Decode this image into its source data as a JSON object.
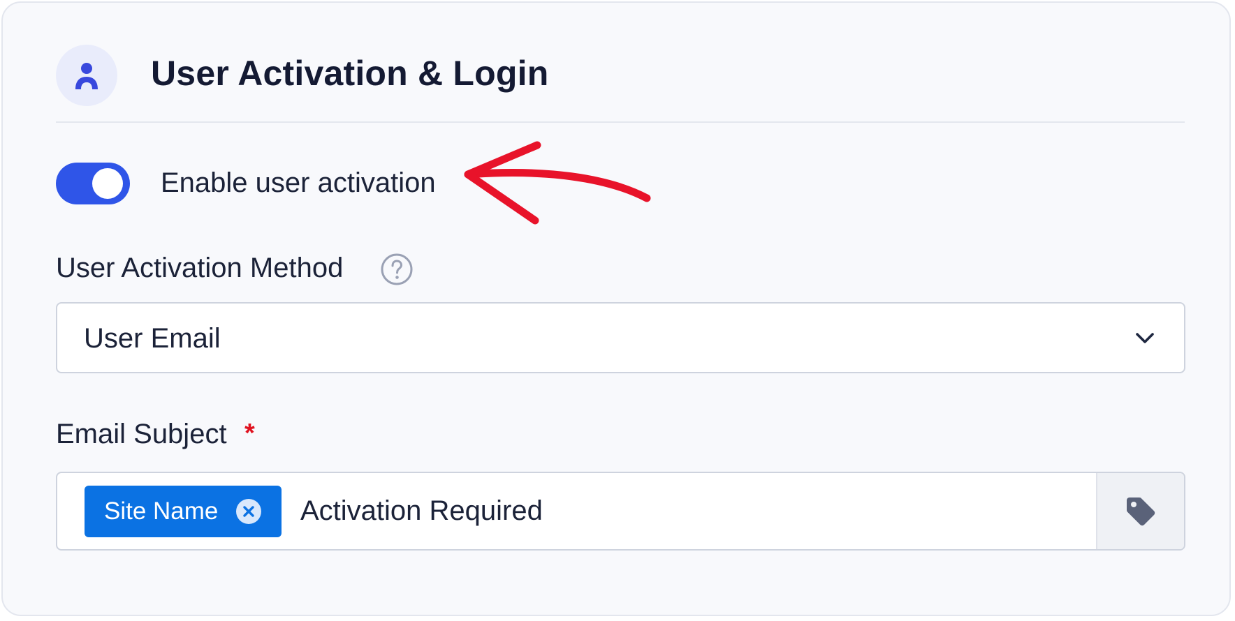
{
  "section": {
    "title": "User Activation & Login",
    "icon": "user-icon"
  },
  "activation_toggle": {
    "label": "Enable user activation",
    "on": true
  },
  "activation_method": {
    "label": "User Activation Method",
    "help_icon": "question-circle-icon",
    "selected": "User Email"
  },
  "email_subject": {
    "label": "Email Subject",
    "required_marker": "*",
    "tag_label": "Site Name",
    "text": "Activation Required",
    "tag_button_icon": "tag-icon"
  },
  "colors": {
    "accent": "#2f55e8",
    "tag_chip": "#0b72e3",
    "annotation_arrow": "#e8132a",
    "required": "#e0121f"
  }
}
